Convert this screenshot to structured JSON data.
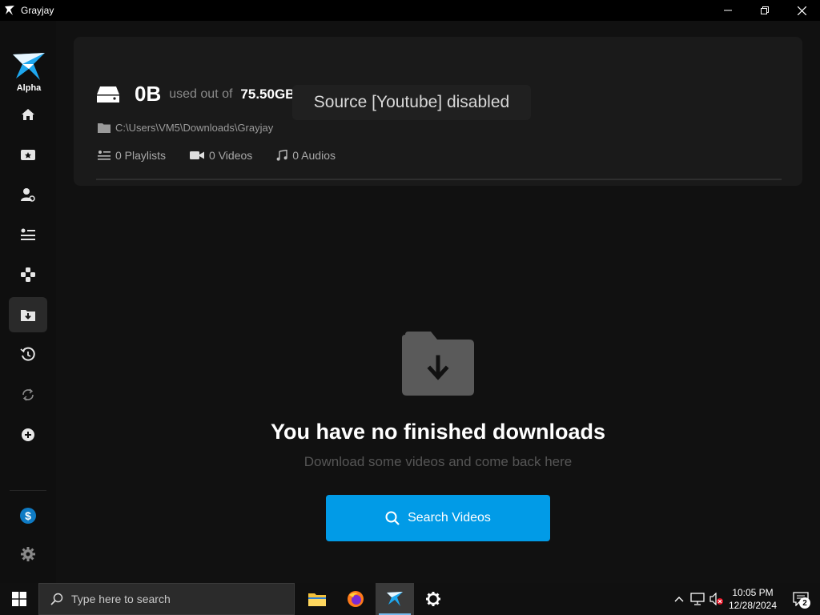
{
  "window": {
    "title": "Grayjay"
  },
  "sidebar": {
    "logo_text": "Alpha",
    "items": [
      {
        "name": "home",
        "icon": "home-icon",
        "active": false
      },
      {
        "name": "subscriptions",
        "icon": "star-card-icon",
        "active": false
      },
      {
        "name": "creators",
        "icon": "user-gear-icon",
        "active": false
      },
      {
        "name": "playlists",
        "icon": "playlist-icon",
        "active": false
      },
      {
        "name": "sources",
        "icon": "sources-icon",
        "active": false
      },
      {
        "name": "downloads",
        "icon": "download-folder-icon",
        "active": true
      },
      {
        "name": "history",
        "icon": "history-icon",
        "active": false
      },
      {
        "name": "sync",
        "icon": "sync-icon",
        "active": false
      },
      {
        "name": "add",
        "icon": "plus-circle-icon",
        "active": false
      }
    ],
    "bottom": [
      {
        "name": "donate",
        "icon": "dollar-icon"
      },
      {
        "name": "settings",
        "icon": "gear-icon"
      }
    ]
  },
  "storage": {
    "used": "0B",
    "used_out_of_label": "used out of",
    "total": "75.50GB",
    "path": "C:\\Users\\VM5\\Downloads\\Grayjay",
    "playlists": "0 Playlists",
    "videos": "0 Videos",
    "audios": "0 Audios"
  },
  "toast": {
    "text": "Source [Youtube] disabled"
  },
  "empty_state": {
    "title": "You have no finished downloads",
    "subtitle": "Download some videos and come back here",
    "button_label": "Search Videos"
  },
  "taskbar": {
    "search_placeholder": "Type here to search",
    "time": "10:05 PM",
    "date": "12/28/2024",
    "notification_count": "2"
  },
  "colors": {
    "accent": "#019be7",
    "background": "#111111",
    "card": "#1a1a1a"
  }
}
